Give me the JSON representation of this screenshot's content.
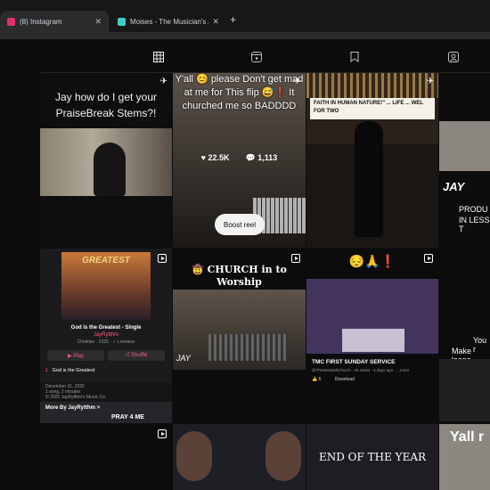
{
  "browser": {
    "tabs": [
      {
        "title": "(8) Instagram",
        "favicon_color": "#e1306c",
        "active": true
      },
      {
        "title": "Moises - The Musician's App",
        "favicon_color": "#3ad0c9",
        "active": false
      }
    ],
    "new_tab_symbol": "+",
    "close_symbol": "✕"
  },
  "profile_tabs": [
    {
      "name": "posts",
      "icon": "grid-icon",
      "selected": true
    },
    {
      "name": "reels",
      "icon": "reels-icon",
      "selected": false
    },
    {
      "name": "saved",
      "icon": "bookmark-icon",
      "selected": false
    },
    {
      "name": "tagged",
      "icon": "tagged-icon",
      "selected": false
    }
  ],
  "posts": {
    "p1": {
      "caption": "Jay how do I get your PraiseBreak Stems?!"
    },
    "p2": {
      "overlay": "Y'all 😊 please Don't get mad at me for This flip 😅❗ It churched me so BADDDD",
      "likes": "22.5K",
      "comments": "1,113",
      "boost": "Boost reel"
    },
    "p3": {
      "sign": "FAITH IN HUMAN NATURE!\" ... LIFE ... WEL FOR TWO"
    },
    "p4": {
      "brand": "JAY",
      "line1": "PRODU",
      "line2": "IN LESS T"
    },
    "p5": {
      "art_title": "GREATEST",
      "song": "God is the Greatest - Single",
      "artist": "JayRytthm",
      "meta": "Christian · 2025 · ✓ Lossless",
      "play": "▶ Play",
      "shuffle": "⤮ Shuffle",
      "track_num": "1",
      "track": "God is the Greatest",
      "released_1": "December 31, 2025",
      "released_2": "1 song, 2 minutes",
      "released_3": "© 2025 JayRytthm's Music Co.",
      "more": "More By JayRytthm >",
      "pray": "PRAY 4 ME"
    },
    "p6": {
      "title": "🤠 CHURCH in to Worship",
      "watermark": "JAY"
    },
    "p7": {
      "emojis": "😔🙏❗",
      "video_title": "TMC FIRST SUNDAY SERVICE",
      "channel": "@TheMessiahChurch · 26 views · 4 days ago · ...more",
      "likes": "6",
      "download": "Download"
    },
    "p8": {
      "line1": "You r",
      "line2": "Make loops"
    },
    "p9": {},
    "p10": {},
    "p11": {
      "headline": "END OF THE YEAR"
    },
    "p12": {
      "headline": "Yall r"
    }
  }
}
